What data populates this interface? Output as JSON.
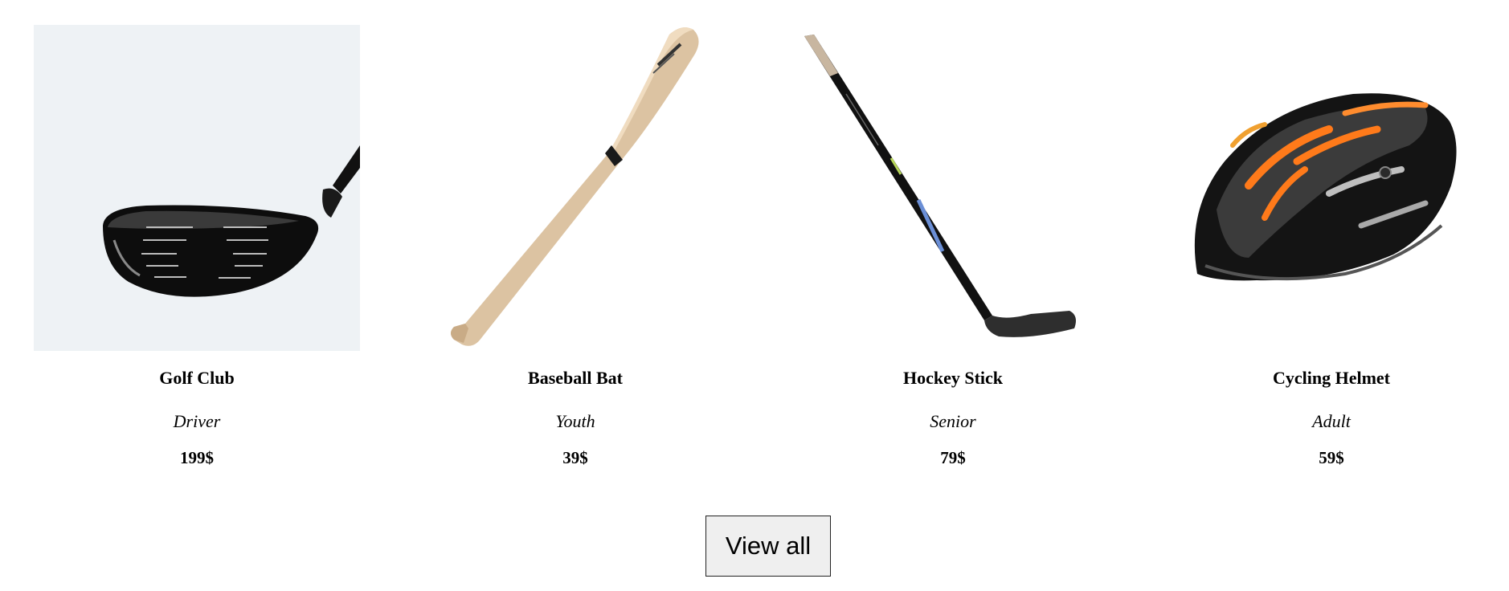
{
  "products": [
    {
      "name": "Golf Club",
      "variant": "Driver",
      "price": "199$",
      "icon": "golf-club-icon"
    },
    {
      "name": "Baseball Bat",
      "variant": "Youth",
      "price": "39$",
      "icon": "baseball-bat-icon"
    },
    {
      "name": "Hockey Stick",
      "variant": "Senior",
      "price": "79$",
      "icon": "hockey-stick-icon"
    },
    {
      "name": "Cycling Helmet",
      "variant": "Adult",
      "price": "59$",
      "icon": "cycling-helmet-icon"
    }
  ],
  "view_all_label": "View all"
}
